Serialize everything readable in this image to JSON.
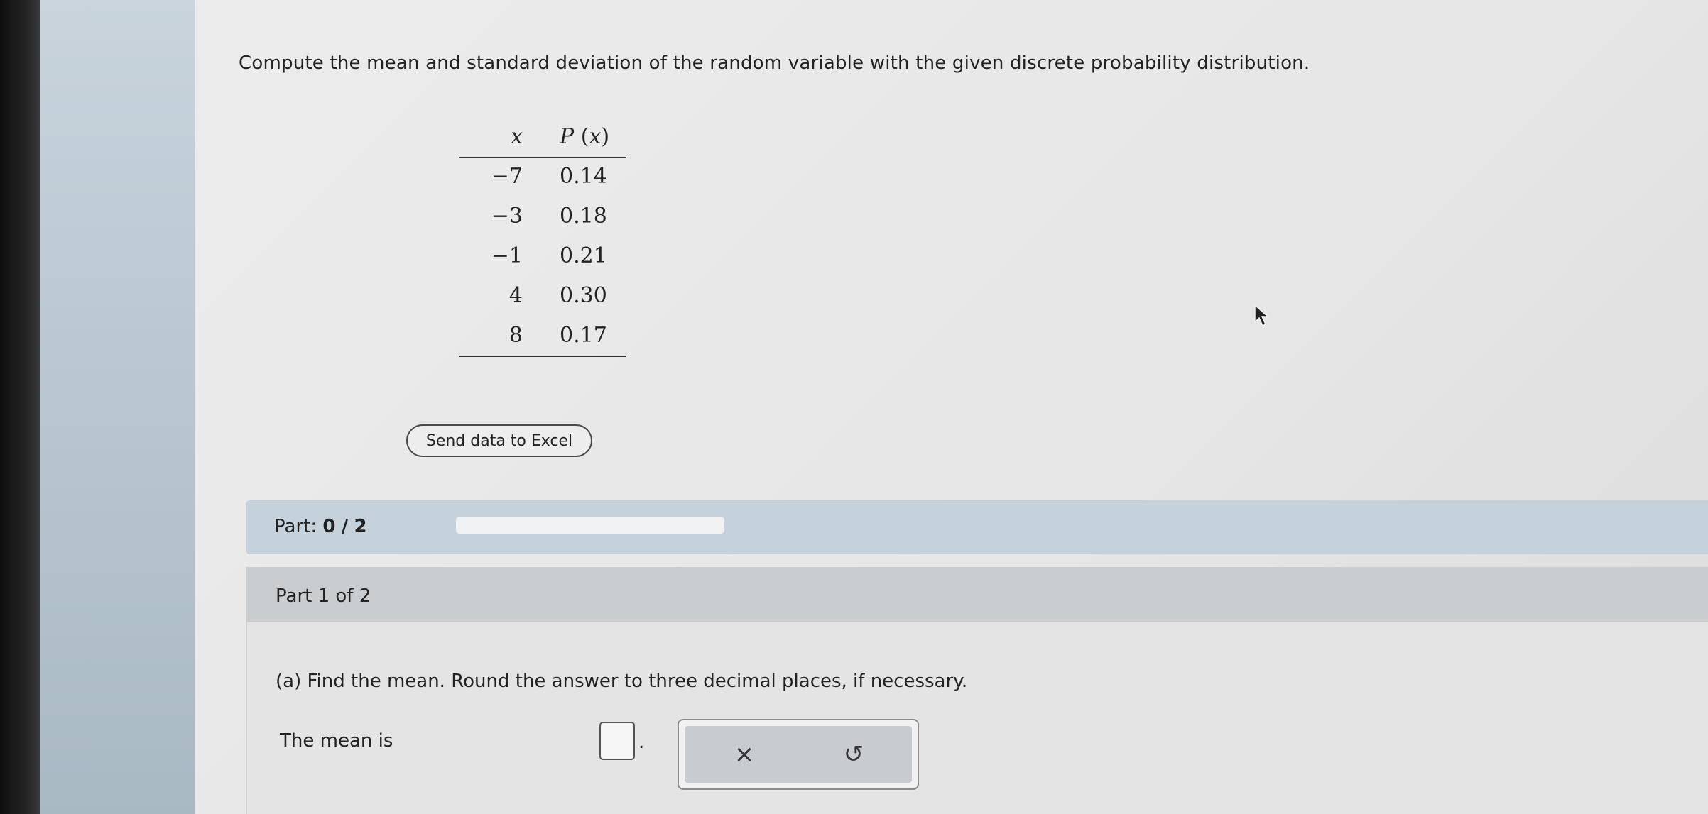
{
  "question": {
    "text": "Compute the mean and standard deviation of the random variable with the given discrete probability distribution."
  },
  "table": {
    "headers": {
      "x": "x",
      "p_prefix": "P",
      "p_arg": "x"
    },
    "rows": [
      {
        "x": "−7",
        "p": "0.14"
      },
      {
        "x": "−3",
        "p": "0.18"
      },
      {
        "x": "−1",
        "p": "0.21"
      },
      {
        "x": "4",
        "p": "0.30"
      },
      {
        "x": "8",
        "p": "0.17"
      }
    ]
  },
  "excel_button": {
    "label": "Send data to Excel"
  },
  "progress": {
    "label": "Part:",
    "current": "0",
    "separator": "/",
    "total": "2",
    "fraction": 0,
    "fill_color": "#3f8f5f"
  },
  "part": {
    "header": "Part 1 of 2",
    "instruction": "(a) Find the mean. Round the answer to three decimal places, if necessary.",
    "mean_label": "The mean is",
    "period": "."
  },
  "tools": {
    "clear_glyph": "×",
    "undo_glyph": "↺",
    "clear_icon": "close-icon",
    "undo_icon": "undo-icon"
  }
}
